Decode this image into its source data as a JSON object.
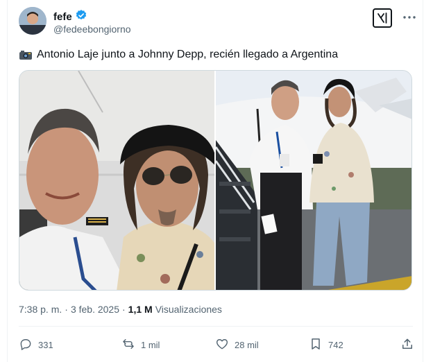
{
  "author": {
    "display_name": "fefe",
    "handle": "@fedeebongiorno",
    "verified": true
  },
  "tweet": {
    "text": "Antonio Laje junto a Johnny Depp, recién llegado a Argentina",
    "emoji": "camera-with-flash"
  },
  "meta": {
    "time": "7:38 p. m.",
    "separator": "·",
    "date": "3 feb. 2025",
    "views_count": "1,1 M",
    "views_label": "Visualizaciones"
  },
  "actions": {
    "replies": "331",
    "reposts": "1 mil",
    "likes": "28 mil",
    "bookmarks": "742"
  },
  "colors": {
    "text": "#0f1419",
    "secondary": "#536471",
    "verified": "#1d9bf0",
    "border": "#eff3f4"
  },
  "icons": [
    "grok-icon",
    "more-icon",
    "verified-badge-icon",
    "reply-icon",
    "repost-icon",
    "like-icon",
    "bookmark-icon",
    "share-icon"
  ]
}
